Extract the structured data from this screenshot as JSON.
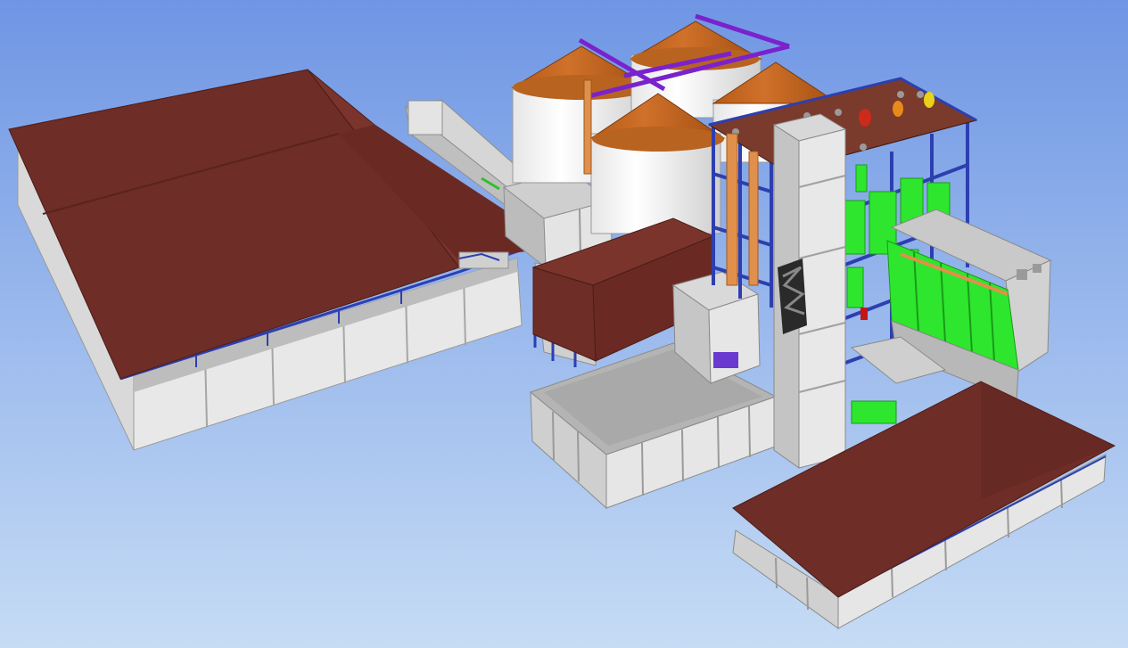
{
  "viewport": {
    "background_top": "#6f96e4",
    "background_bottom": "#c6dcf5"
  },
  "palette": {
    "roof": "#6e2d26",
    "roof_light": "#7b342c",
    "wall": "#e2e2e2",
    "wall_shade": "#c4c4c4",
    "steel": "#2d3fb0",
    "silo_roof": "#c0621a",
    "silo_body": "#f2f2f2",
    "equipment": "#2ee62e",
    "conveyor_purple": "#7a22cc",
    "elevator_orange": "#e0904a"
  },
  "objects": [
    {
      "name": "warehouse-left"
    },
    {
      "name": "conveyor-gallery"
    },
    {
      "name": "silo-group"
    },
    {
      "name": "process-tower"
    },
    {
      "name": "elevator-leg"
    },
    {
      "name": "green-bin-block"
    },
    {
      "name": "intake-building"
    },
    {
      "name": "warehouse-right"
    }
  ]
}
